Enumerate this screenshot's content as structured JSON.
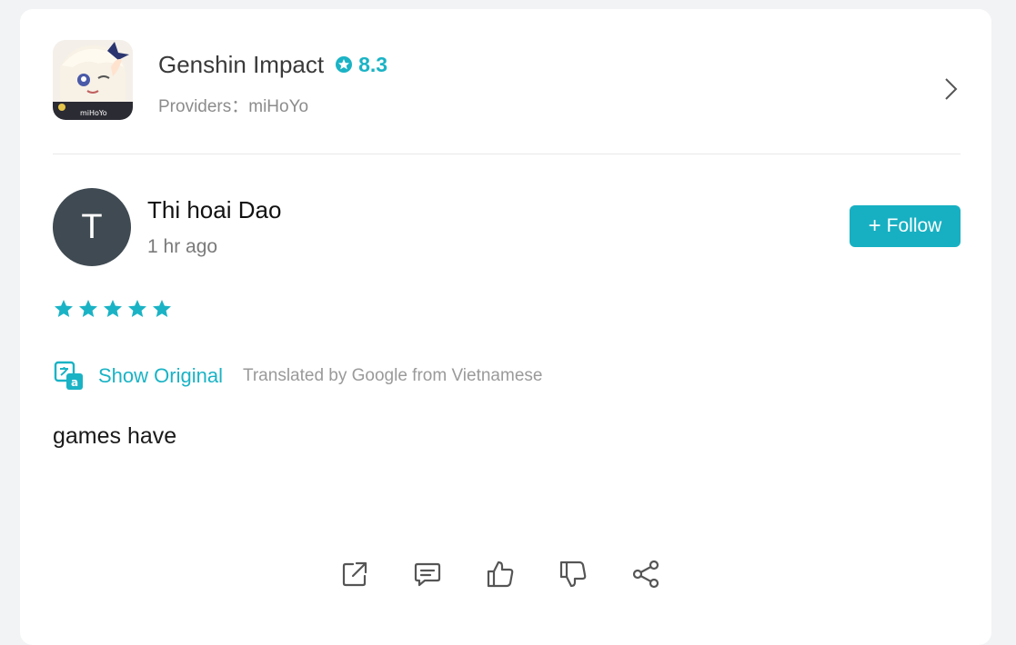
{
  "app": {
    "name": "Genshin Impact",
    "score": "8.3",
    "providers": "Providers：miHoYo",
    "icon_text": "miHoYo"
  },
  "review": {
    "avatar_initial": "T",
    "reviewer_name": "Thi hoai Dao",
    "time": "1 hr ago",
    "follow_plus": "+",
    "follow_label": "Follow",
    "rating": 5,
    "show_original": "Show Original",
    "translated_note": "Translated by Google from Vietnamese",
    "text": "games have"
  },
  "actions": [
    "open-external-icon",
    "comment-icon",
    "thumbs-up-icon",
    "thumbs-down-icon",
    "share-icon"
  ],
  "colors": {
    "accent": "#1ab3c5",
    "avatar_bg": "#3f4a52",
    "follow_bg": "#17b0c2"
  }
}
